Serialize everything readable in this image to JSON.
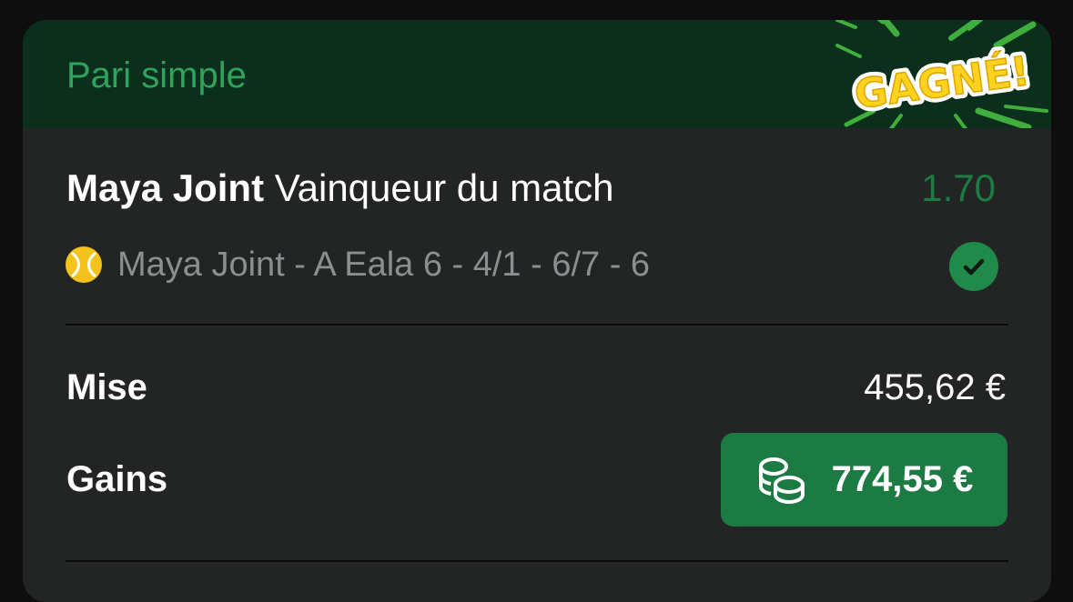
{
  "header": {
    "bet_type": "Pari simple",
    "badge_text": "GAGNÉ!"
  },
  "selection": {
    "player": "Maya Joint",
    "market": "Vainqueur du match",
    "odds": "1.70"
  },
  "event": {
    "sport_icon": "tennis-ball-icon",
    "label": "Maya Joint - A Eala 6 - 4/1 - 6/7 - 6",
    "status_icon": "check-circle-icon"
  },
  "stake": {
    "label": "Mise",
    "value": "455,62 €"
  },
  "winnings": {
    "label": "Gains",
    "icon": "coins-icon",
    "value": "774,55 €"
  },
  "colors": {
    "header_bg": "#0c2e1c",
    "card_bg": "#222523",
    "accent_green": "#2fa35b",
    "odds_green": "#1d7a43",
    "pill_green": "#1c7a43",
    "badge_yellow": "#ffd21f"
  }
}
